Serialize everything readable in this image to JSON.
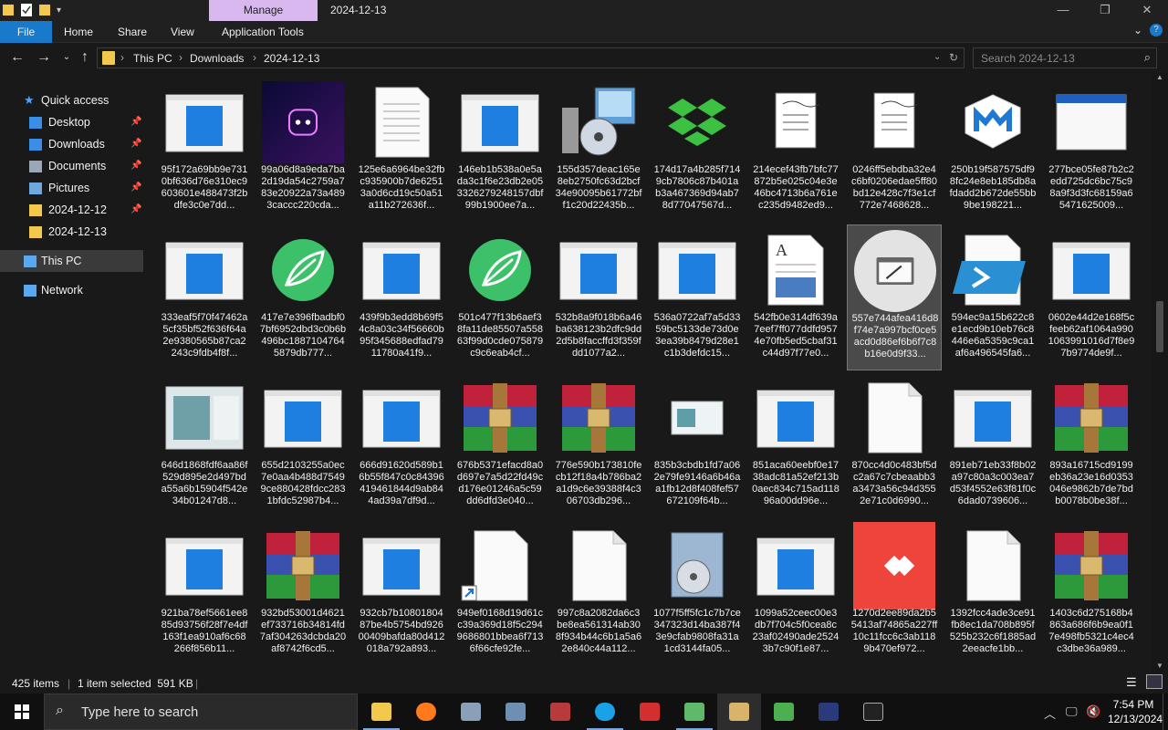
{
  "titlebar": {
    "manage_label": "Manage",
    "title": "2024-12-13",
    "minimize": "—",
    "maximize": "❐",
    "close": "✕"
  },
  "ribbon": {
    "tabs": [
      "File",
      "Home",
      "Share",
      "View",
      "Application Tools"
    ]
  },
  "address": {
    "crumbs": [
      "This PC",
      "Downloads",
      "2024-12-13"
    ]
  },
  "search": {
    "placeholder": "Search 2024-12-13"
  },
  "sidebar": {
    "items": [
      {
        "label": "Quick access",
        "icon": "star-icon"
      },
      {
        "label": "Desktop",
        "icon": "desktop-icon",
        "pinned": true
      },
      {
        "label": "Downloads",
        "icon": "download-icon",
        "pinned": true
      },
      {
        "label": "Documents",
        "icon": "documents-icon",
        "pinned": true
      },
      {
        "label": "Pictures",
        "icon": "pictures-icon",
        "pinned": true
      },
      {
        "label": "2024-12-12",
        "icon": "folder-icon",
        "pinned": true
      },
      {
        "label": "2024-12-13",
        "icon": "folder-icon"
      },
      {
        "label": "This PC",
        "icon": "computer-icon",
        "selected": true
      },
      {
        "label": "Network",
        "icon": "network-icon"
      }
    ]
  },
  "files": [
    {
      "name": "95f172a69bb9e7310bf636d76e310ec9603601e488473f2bdfe3c0e7dd...",
      "icon": "window-app-icon"
    },
    {
      "name": "99a06d8a9eda7ba2d19da54c2759a783e20922a73a4893caccc220cda...",
      "icon": "discord-icon"
    },
    {
      "name": "125e6a6964be32fbc935900b7de62513a0d6cd19c50a51a11b272636f...",
      "icon": "text-document-icon"
    },
    {
      "name": "146eb1b538a0e5ada3c1f6e23db2e053326279248157dbf99b1900ee7a...",
      "icon": "window-app-icon"
    },
    {
      "name": "155d357deac165e8eb2750fc63d2bcf34e90095b61772bff1c20d22435b...",
      "icon": "installer-icon"
    },
    {
      "name": "174d17a4b285f7149cb7806c87b401ab3a467369d94ab78d77047567d...",
      "icon": "dropbox-icon"
    },
    {
      "name": "214ecef43fb7bfc77872b5e025c04e3e46bc4713b6a761ec235d9482ed9...",
      "icon": "script-icon"
    },
    {
      "name": "0246ff5ebdba32e4c6bf0206edae5ff80bd12e428c7f3e1cf772e7468628...",
      "icon": "script-icon"
    },
    {
      "name": "250b19f587575df98fc24e8eb185db8afdadd2b672de55bb9be198221...",
      "icon": "malwarebytes-icon"
    },
    {
      "name": "277bce05fe87b2c2edd725dc6bc75c98a9f3d3fc68159a65471625009...",
      "icon": "window-frame-icon"
    },
    {
      "name": "333eaf5f70f47462a5cf35bf52f636f64a2e9380565b87ca2243c9fdb4f8f...",
      "icon": "window-app-icon"
    },
    {
      "name": "417e7e396fbadbf07bf6952dbd3c0b6b496bc18871047645879db777...",
      "icon": "leaf-icon"
    },
    {
      "name": "439f9b3edd8b69f54c8a03c34f56660b95f345688edfad7911780a41f9...",
      "icon": "window-app-icon"
    },
    {
      "name": "501c477f13b6aef38fa11de85507a55863f99d0cde075879c9c6eab4cf...",
      "icon": "leaf-icon"
    },
    {
      "name": "532b8a9f018b6a46ba638123b2dfc9dd2d5b8faccffd3f359fdd1077a2...",
      "icon": "window-app-icon"
    },
    {
      "name": "536a0722af7a5d3359bc5133de73d0e3ea39b8479d28e1c1b3defdc15...",
      "icon": "window-app-icon"
    },
    {
      "name": "542fb0e314df639a7eef7ff077ddfd9574e70fb5ed5cbaf31c44d97f77e0...",
      "icon": "wordpad-icon"
    },
    {
      "name": "557e744afea416d8f74e7a997bcf0ce5acd0d86ef6b6f7c8b16e0d9f33...",
      "icon": "app-wand-icon",
      "selected": true
    },
    {
      "name": "594ec9a15b622c8e1ecd9b10eb76c8446e6a5359c9ca1af6a496545fa6...",
      "icon": "powershell-icon"
    },
    {
      "name": "0602e44d2e168f5cfeeb62af1064a9901063991016d7f8e97b9774de9f...",
      "icon": "window-app-icon"
    },
    {
      "name": "646d1868fdf6aa86f529d895e2d497bda55a6b15904f542e34b01247d8...",
      "icon": "blurred-window-icon"
    },
    {
      "name": "655d2103255a0ec7e0aa4b488d75499ce880428fdcc2831bfdc52987b4...",
      "icon": "window-app-icon"
    },
    {
      "name": "666d91620d589b16b55f847c0c84396419461844d9ab844ad39a7df9d...",
      "icon": "window-app-icon"
    },
    {
      "name": "676b5371efacd8a0d697e7a5d22fd49cd176e01246a5c59dd6dfd3e040...",
      "icon": "winrar-icon"
    },
    {
      "name": "776e590b173810fecb12f18a4b786ba2a1d9c6e39388f4c306703db296...",
      "icon": "winrar-icon"
    },
    {
      "name": "835b3cbdb1fd7a062e79fe9146a6b46aa1fb12d8f408fef57672109f64b...",
      "icon": "app-thumb-icon"
    },
    {
      "name": "851aca60eebf0e1738adc81a52ef213b0aec834c715ad11896a00dd96e...",
      "icon": "window-app-icon"
    },
    {
      "name": "870cc4d0c483bf5dc2a67c7cbeaabb3a3473a56c94d3552e71c0d6990...",
      "icon": "blank-document-icon"
    },
    {
      "name": "891eb71eb33f8b02a97c80a3c003ea7d53f4552e63f81f0c6dad0739606...",
      "icon": "window-app-icon"
    },
    {
      "name": "893a16715cd9199eb36a23e16d0353046e9862b7de7bdb0078b0be38f...",
      "icon": "winrar-icon"
    },
    {
      "name": "921ba78ef5661ee885d93756f28f7e4df163f1ea910af6c68266f856b11...",
      "icon": "window-app-icon"
    },
    {
      "name": "932bd53001d4621ef733716b34814fd7af304263dcbda20af8742f6cd5...",
      "icon": "winrar-icon"
    },
    {
      "name": "932cb7b1080180487be4b5754bd92600409bafda80d412018a792a893...",
      "icon": "window-app-icon"
    },
    {
      "name": "949ef0168d19d61cc39a369d18f5c2949686801bbea6f7136f66cfe92fe...",
      "icon": "shortcut-document-icon"
    },
    {
      "name": "997c8a2082da6c3be8ea561314ab308f934b44c6b1a5a62e840c44a112...",
      "icon": "blank-document-icon"
    },
    {
      "name": "1077f5ff5fc1c7b7ce347323d14ba387f43e9cfab9808fa31a1cd3144fa05...",
      "icon": "installer-box-icon"
    },
    {
      "name": "1099a52ceec00e3db7f704c5f0cea8c23af02490ade25243b7c90f1e87...",
      "icon": "window-app-icon"
    },
    {
      "name": "1270d2ee89da2b55413af74865a227ff10c11fcc6c3ab1189b470ef972...",
      "icon": "anydesk-icon"
    },
    {
      "name": "1392fcc4ade3ce91fb8ec1da708b895f525b232c6f1885ad2eeacfe1bb...",
      "icon": "blank-document-icon"
    },
    {
      "name": "1403c6d275168b4863a686f6b9ea0f17e498fb5321c4ec4c3dbe36a989...",
      "icon": "winrar-icon"
    }
  ],
  "status": {
    "item_count": "425 items",
    "selection": "1 item selected  591 KB"
  },
  "taskbar": {
    "search_placeholder": "Type here to search",
    "time": "7:54 PM",
    "date": "12/13/2024",
    "apps": [
      "file-explorer-icon",
      "firefox-icon",
      "terminal-app-icon",
      "screen-app-icon",
      "winrar-icon",
      "edge-icon",
      "red-app-icon",
      "network-app-icon",
      "wordpad-app-icon",
      "sheet-app-icon",
      "dark-app-icon",
      "cmd-icon"
    ]
  },
  "colors": {
    "accent": "#1979ca",
    "manage": "#d9b8f0",
    "background": "#191919"
  }
}
